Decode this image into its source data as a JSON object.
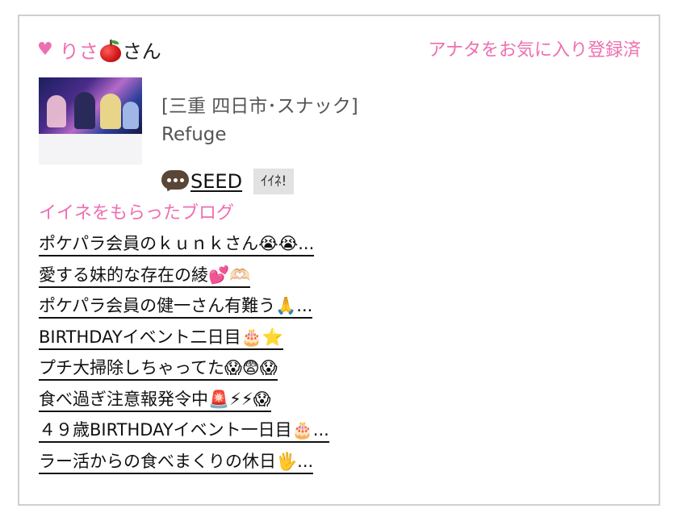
{
  "user": {
    "name_prefix": "りさ",
    "name_suffix": "さん",
    "emoji": "apple-emoji"
  },
  "favorite_status": "アナタをお気に入り登録済",
  "shop": {
    "area": "[三重 四日市･スナック]",
    "name": "Refuge"
  },
  "comment": {
    "icon": "speech-bubble-icon",
    "text": "SEED",
    "like_label": "ｲｲﾈ!"
  },
  "blog_section": {
    "title": "イイネをもらったブログ",
    "items": [
      "ポケパラ会員のｋｕｎｋさん😭😭...",
      "愛する妹的な存在の綾💕🫶🏻",
      "ポケパラ会員の健一さん有難う🙏...",
      "BIRTHDAYイベント二日目🎂⭐",
      "プチ大掃除しちゃってた😱😨😱",
      "食べ過ぎ注意報発令中🚨⚡⚡😱",
      "４９歳BIRTHDAYイベント一日目🎂...",
      "ラー活からの食べまくりの休日🖐..."
    ]
  },
  "colors": {
    "accent_pink": "#ee6fb0",
    "border": "#cfcfcf",
    "text": "#222222",
    "muted": "#555555",
    "button_bg": "#e2e2e2"
  }
}
